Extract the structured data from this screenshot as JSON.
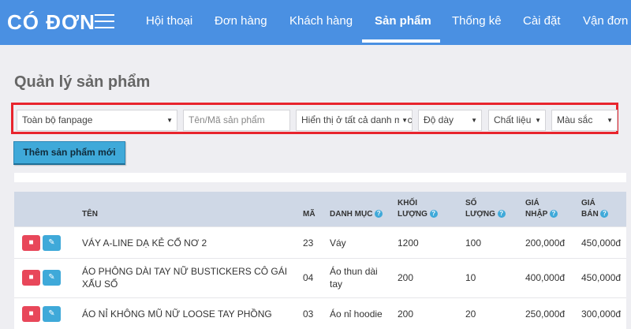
{
  "brand": "CÓ ĐƠN",
  "nav": [
    {
      "label": "Hội thoại",
      "active": false
    },
    {
      "label": "Đơn hàng",
      "active": false
    },
    {
      "label": "Khách hàng",
      "active": false
    },
    {
      "label": "Sản phẩm",
      "active": true
    },
    {
      "label": "Thống kê",
      "active": false
    },
    {
      "label": "Cài đặt",
      "active": false
    },
    {
      "label": "Vận đơn",
      "active": false
    }
  ],
  "page_title": "Quản lý sản phẩm",
  "filters": {
    "fanpage": "Toàn bộ fanpage",
    "search_placeholder": "Tên/Mã sản phẩm",
    "category": "Hiển thị ở tất cả danh mục",
    "thickness": "Độ dày",
    "material": "Chất liệu",
    "color": "Màu sắc"
  },
  "add_button": "Thêm sản phẩm mới",
  "table": {
    "headers": {
      "name": "Tên",
      "code": "Mã",
      "category": "Danh mục",
      "weight_1": "Khối",
      "weight_2": "lượng",
      "qty_1": "Số",
      "qty_2": "lượng",
      "cost_1": "Giá",
      "cost_2": "nhập",
      "price_1": "Giá",
      "price_2": "bán"
    },
    "rows": [
      {
        "name": "VÁY A-LINE DẠ KẺ CỔ NƠ 2",
        "code": "23",
        "category": "Váy",
        "weight": "1200",
        "qty": "100",
        "cost": "200,000đ",
        "price": "450,000đ"
      },
      {
        "name": "ÁO PHÔNG DÀI TAY NỮ BUSTICKERS CÔ GÁI XẤU SỐ",
        "code": "04",
        "category": "Áo thun dài tay",
        "weight": "200",
        "qty": "10",
        "cost": "400,000đ",
        "price": "450,000đ"
      },
      {
        "name": "ÁO NỈ KHÔNG MŨ NỮ LOOSE TAY PHỒNG",
        "code": "03",
        "category": "Áo nỉ hoodie",
        "weight": "200",
        "qty": "20",
        "cost": "250,000đ",
        "price": "300,000đ"
      }
    ]
  }
}
